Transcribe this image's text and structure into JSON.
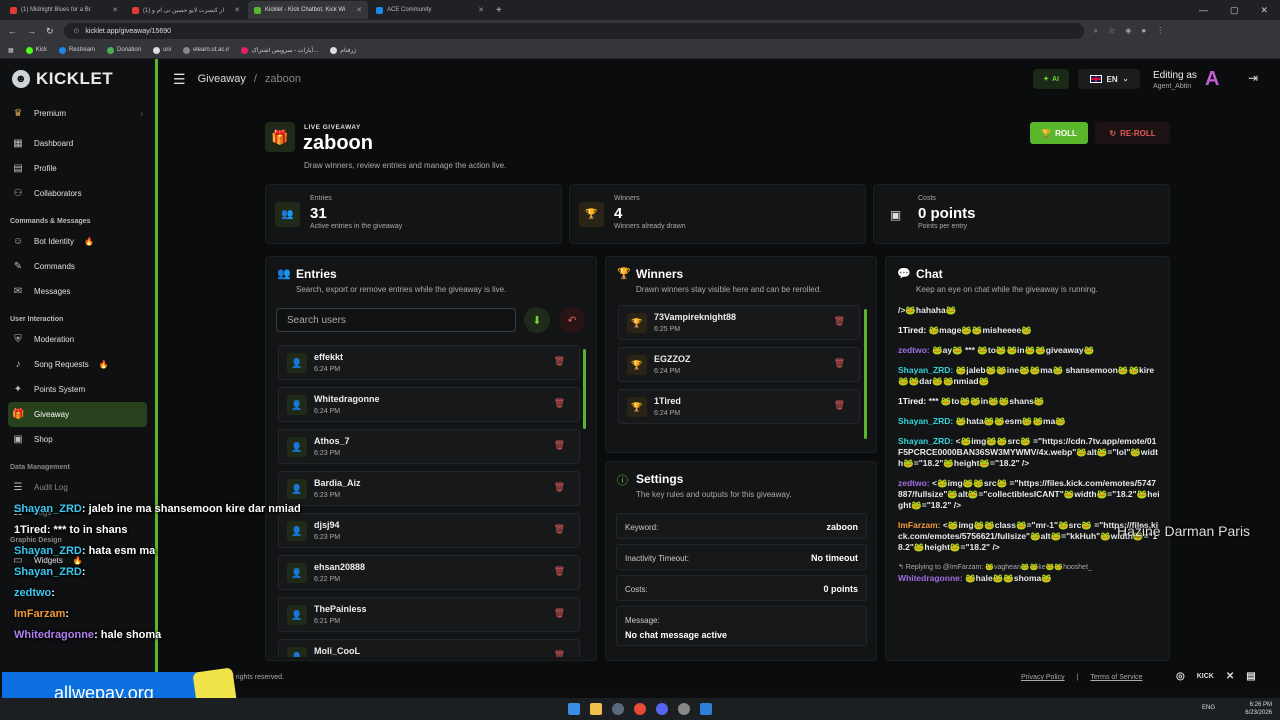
{
  "browser": {
    "tabs": [
      {
        "label": "(1) Midnight Blues for a Br",
        "color": "#e53935"
      },
      {
        "label": "(1) از کنسرت لایو حسین تی ام و",
        "color": "#e53935"
      },
      {
        "label": "Kicklet - Kick Chatbot, Kick Wi",
        "color": "#5ab72c"
      },
      {
        "label": "ACE Community",
        "color": "#1e88e5"
      }
    ],
    "url": "kicklet.app/giveaway/15690",
    "bookmarks": [
      "Kick",
      "Restream",
      "Donation",
      "uni",
      "elearn.ut.ac.ir",
      "آپارات - سرویس اشتراک...",
      "ژرفنام"
    ]
  },
  "sidebar": {
    "brand": "KICKLET",
    "premium": "Premium",
    "main_items": [
      "Dashboard",
      "Profile",
      "Collaborators"
    ],
    "section_commands": "Commands & Messages",
    "commands_items": [
      "Bot Identity",
      "Commands",
      "Messages"
    ],
    "section_interaction": "User Interaction",
    "interaction_items": [
      "Moderation",
      "Song Requests",
      "Points System",
      "Giveaway",
      "Shop"
    ],
    "section_data": "Data Management",
    "data_items": [
      "Audit Log",
      "Logs"
    ],
    "section_graphic": "Graphic Design",
    "graphic_items": [
      "Widgets"
    ]
  },
  "topbar": {
    "breadcrumb_root": "Giveaway",
    "breadcrumb_sep": "/",
    "breadcrumb_current": "zaboon",
    "ai_label": "AI",
    "lang_label": "EN",
    "editing_as": "Editing as",
    "editing_user": "Agent_Abtin"
  },
  "giveaway": {
    "live_label": "LIVE GIVEAWAY",
    "title": "zaboon",
    "subtitle": "Draw winners, review entries and manage the action live.",
    "roll_label": "ROLL",
    "reroll_label": "RE-ROLL"
  },
  "stats": [
    {
      "label": "Entries",
      "value": "31",
      "hint": "Active entries in the giveaway"
    },
    {
      "label": "Winners",
      "value": "4",
      "hint": "Winners already drawn"
    },
    {
      "label": "Costs",
      "value": "0 points",
      "hint": "Points per entry"
    }
  ],
  "entries_panel": {
    "title": "Entries",
    "subtitle": "Search, export or remove entries while the giveaway is live.",
    "search_placeholder": "Search users",
    "items": [
      {
        "name": "effekkt",
        "time": "6:24 PM"
      },
      {
        "name": "Whitedragonne",
        "time": "6:24 PM"
      },
      {
        "name": "Athos_7",
        "time": "6:23 PM"
      },
      {
        "name": "Bardia_Aiz",
        "time": "6:23 PM"
      },
      {
        "name": "djsj94",
        "time": "6:23 PM"
      },
      {
        "name": "ehsan20888",
        "time": "6:22 PM"
      },
      {
        "name": "ThePainless",
        "time": "6:21 PM"
      },
      {
        "name": "Moli_CooL",
        "time": ""
      }
    ]
  },
  "winners_panel": {
    "title": "Winners",
    "subtitle": "Drawn winners stay visible here and can be rerolled.",
    "items": [
      {
        "name": "73Vampireknight88",
        "time": "6:25 PM"
      },
      {
        "name": "EGZZOZ",
        "time": "6:24 PM"
      },
      {
        "name": "1Tired",
        "time": "6:24 PM"
      }
    ]
  },
  "settings_panel": {
    "title": "Settings",
    "subtitle": "The key rules and outputs for this giveaway.",
    "rows": [
      {
        "key": "Keyword:",
        "value": "zaboon"
      },
      {
        "key": "Inactivity Timeout:",
        "value": "No timeout"
      },
      {
        "key": "Costs:",
        "value": "0 points"
      }
    ],
    "message_label": "Message:",
    "message_value": "No chat message active"
  },
  "chat_panel": {
    "title": "Chat",
    "subtitle": "Keep an eye on chat while the giveaway is running.",
    "lines": [
      {
        "user": "",
        "cls": "u-white",
        "text": "/>🐸hahaha🐸"
      },
      {
        "user": "1Tired:",
        "cls": "u-white",
        "text": "🐸mage🐸🐸misheeee🐸"
      },
      {
        "user": "zedtwo:",
        "cls": "u-purple",
        "text": "🐸ay🐸 *** 🐸to🐸🐸in🐸🐸giveaway🐸"
      },
      {
        "user": "Shayan_ZRD:",
        "cls": "u-cyan",
        "text": "🐸jaleb🐸🐸ine🐸🐸ma🐸 shansemoon🐸🐸kire🐸🐸dar🐸🐸nmiad🐸"
      },
      {
        "user": "1Tired:",
        "cls": "u-white",
        "text": "*** 🐸to🐸🐸in🐸🐸shans🐸"
      },
      {
        "user": "Shayan_ZRD:",
        "cls": "u-cyan",
        "text": "🐸hata🐸🐸esm🐸🐸ma🐸"
      },
      {
        "user": "Shayan_ZRD:",
        "cls": "u-cyan",
        "text": "<🐸img🐸🐸src🐸 =\"https://cdn.7tv.app/emote/01F5PCRCE0000BAN36SW3MYWMV/4x.webp\"🐸alt🐸=\"lol\"🐸width🐸=\"18.2\"🐸height🐸=\"18.2\" />"
      },
      {
        "user": "zedtwo:",
        "cls": "u-purple",
        "text": "<🐸img🐸🐸src🐸 =\"https://files.kick.com/emotes/5747887/fullsize\"🐸alt🐸=\"collectiblesICANT\"🐸width🐸=\"18.2\"🐸height🐸=\"18.2\" />"
      },
      {
        "user": "ImFarzam:",
        "cls": "u-orange",
        "text": "<🐸img🐸🐸class🐸=\"mr-1\"🐸src🐸 =\"https://files.kick.com/emotes/5756621/fullsize\"🐸alt🐸=\"kkHuh\"🐸width🐸=\"18.2\"🐸height🐸=\"18.2\" />"
      }
    ],
    "reply_text": "↰ Replying to @ImFarzam: 🐸vaghean🐸🐸ke🐸🐸hooshet_",
    "last_user": "Whitedragonne:",
    "last_text": "🐸hale🐸🐸shoma🐸"
  },
  "footer": {
    "rights": "All rights reserved.",
    "privacy": "Privacy Policy",
    "divider": "|",
    "terms": "Terms of Service",
    "kick": "KICK"
  },
  "overlay": {
    "lines": [
      {
        "user": "Shayan_ZRD",
        "text": ": jaleb ine ma shansemoon kire dar nmiad"
      },
      {
        "user": "1Tired",
        "text": ": *** to in shans"
      },
      {
        "user": "Shayan_ZRD",
        "text": ": hata esm ma"
      },
      {
        "user": "Shayan_ZRD",
        "text": ":"
      },
      {
        "user": "zedtwo",
        "text": ":"
      },
      {
        "user": "ImFarzam",
        "text": ":"
      },
      {
        "user": "Whitedragonne",
        "text": ": hale shoma"
      }
    ],
    "right_text": "Hazine Darman Paris",
    "promo": "allwepay.org"
  },
  "taskbar": {
    "lang": "ENG",
    "time": "6:26 PM",
    "date": "6/23/2026"
  }
}
